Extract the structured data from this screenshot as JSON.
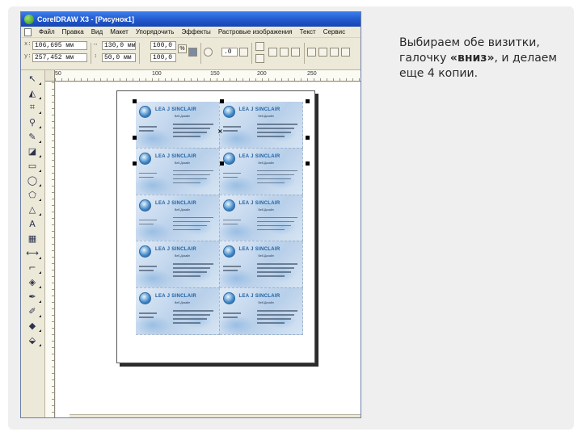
{
  "window": {
    "title": "CorelDRAW X3 - [Рисунок1]"
  },
  "menu": {
    "items": [
      "Файл",
      "Правка",
      "Вид",
      "Макет",
      "Упорядочить",
      "Эффекты",
      "Растровые изображения",
      "Текст",
      "Сервис"
    ]
  },
  "properties": {
    "x": "106,695 мм",
    "y": "257,452 мм",
    "width": "130,0 мм",
    "height": "50,0 мм",
    "scale_w": "100,0",
    "scale_h": "100,0",
    "rotation": ".0",
    "unit_mark": "%"
  },
  "ruler": {
    "ticks": [
      "50",
      "100",
      "150",
      "200",
      "250"
    ]
  },
  "toolbox": {
    "tools": [
      "pick-tool",
      "shape-tool",
      "crop-tool",
      "zoom-tool",
      "freehand-tool",
      "smart-fill-tool",
      "rectangle-tool",
      "ellipse-tool",
      "polygon-tool",
      "basic-shapes-tool",
      "text-tool",
      "table-tool",
      "dimension-tool",
      "connector-tool",
      "interactive-blend-tool",
      "eyedropper-tool",
      "outline-tool",
      "fill-tool"
    ]
  },
  "business_card": {
    "brand": "LEA J SINCLAIR",
    "role": "Веб-Дизайн"
  },
  "caption": {
    "line1": "Выбираем обе визитки, галочку ",
    "emphasis": "«вниз»",
    "line2": ", и делаем еще 4 копии."
  },
  "colors": {
    "titlebar": "#1f55c9",
    "window_bg": "#ece9d8",
    "card_blue": "#1f5fa0"
  }
}
